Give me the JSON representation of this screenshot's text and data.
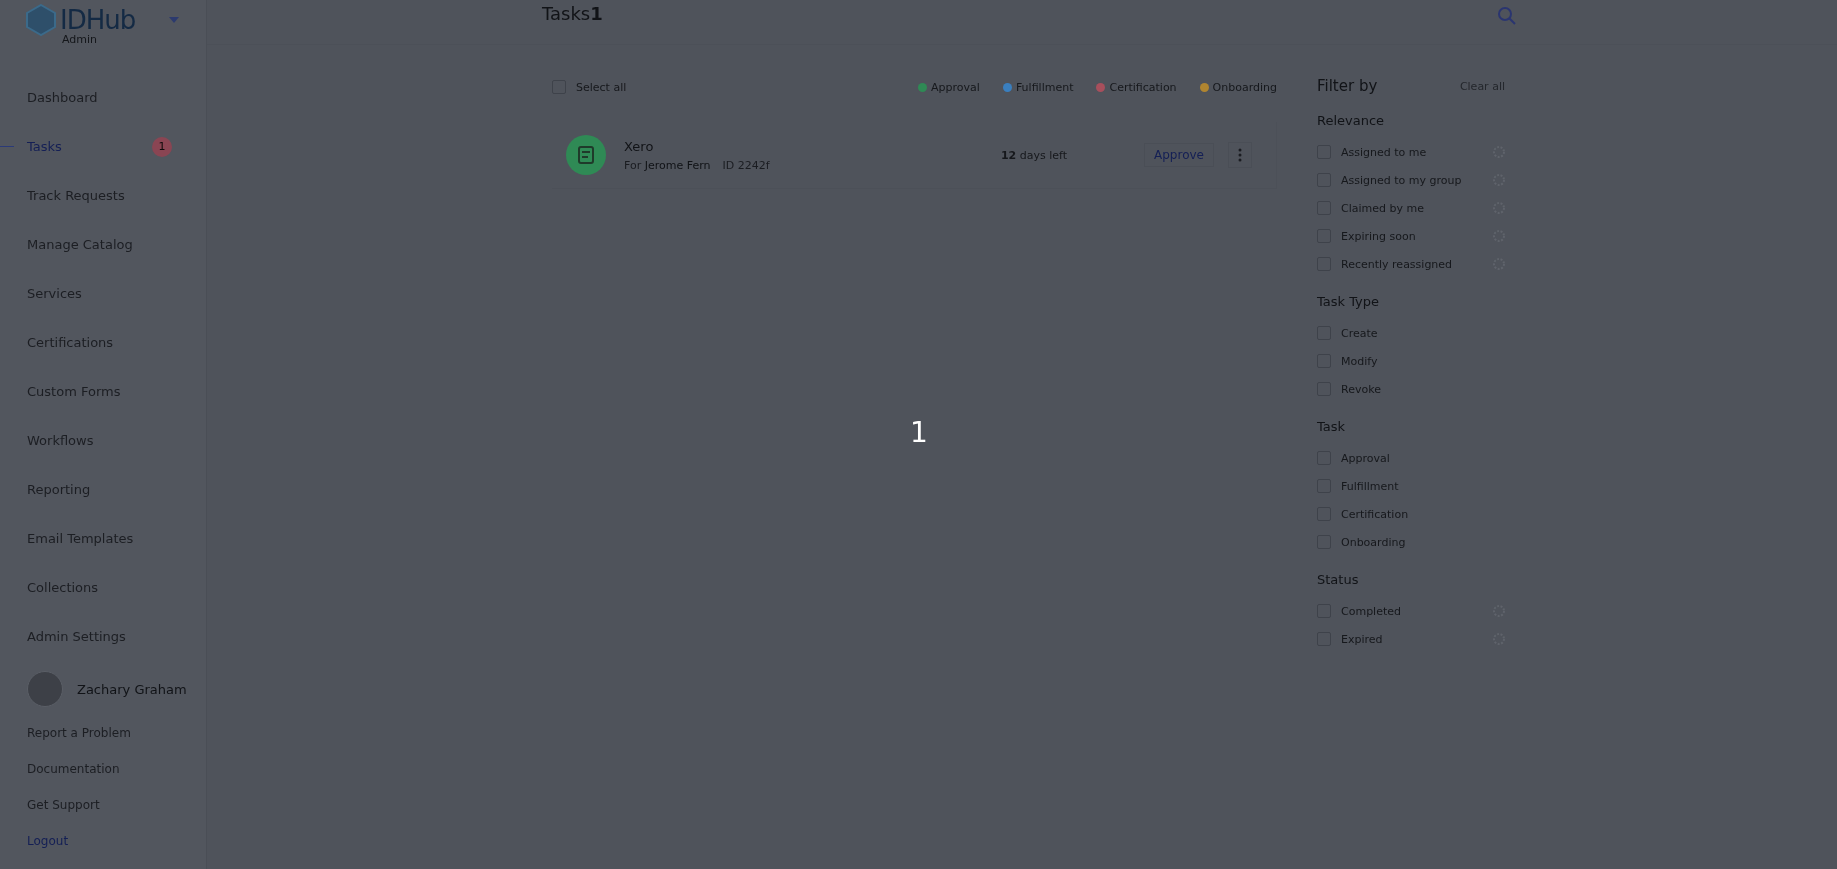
{
  "brand": {
    "name": "IDHub",
    "role": "Admin"
  },
  "nav": [
    {
      "label": "Dashboard",
      "selected": false
    },
    {
      "label": "Tasks",
      "selected": true,
      "badge": "1"
    },
    {
      "label": "Track Requests",
      "selected": false
    },
    {
      "label": "Manage Catalog",
      "selected": false
    },
    {
      "label": "Services",
      "selected": false
    },
    {
      "label": "Certifications",
      "selected": false
    },
    {
      "label": "Custom Forms",
      "selected": false
    },
    {
      "label": "Workflows",
      "selected": false
    },
    {
      "label": "Reporting",
      "selected": false
    },
    {
      "label": "Email Templates",
      "selected": false
    },
    {
      "label": "Collections",
      "selected": false
    },
    {
      "label": "Admin Settings",
      "selected": false
    }
  ],
  "user": {
    "name": "Zachary Graham"
  },
  "footer_links": [
    {
      "label": "Report a Problem",
      "selected": false
    },
    {
      "label": "Documentation",
      "selected": false
    },
    {
      "label": "Get Support",
      "selected": false
    },
    {
      "label": "Logout",
      "selected": true
    }
  ],
  "header": {
    "title": "Tasks",
    "count": "1"
  },
  "toolbar": {
    "select_all": {
      "label": "Select all",
      "checked": false
    },
    "legend": [
      {
        "label": "Approval",
        "color": "#2f8a55"
      },
      {
        "label": "Fulfillment",
        "color": "#3a7fbf"
      },
      {
        "label": "Certification",
        "color": "#a84f5c"
      },
      {
        "label": "Onboarding",
        "color": "#b08530"
      }
    ]
  },
  "tasks": [
    {
      "title": "Xero",
      "for_label": "For",
      "for_name": "Jerome Fern",
      "id": "ID 2242f",
      "days": "12",
      "days_suffix": "days left",
      "action": "Approve",
      "color": "#2f8a55"
    }
  ],
  "filters": {
    "title": "Filter by",
    "clear": "Clear all",
    "groups": [
      {
        "title": "Relevance",
        "items": [
          {
            "label": "Assigned to me",
            "checked": false,
            "loading": true
          },
          {
            "label": "Assigned to my group",
            "checked": false,
            "loading": true
          },
          {
            "label": "Claimed by me",
            "checked": false,
            "loading": true
          },
          {
            "label": "Expiring soon",
            "checked": false,
            "loading": true
          },
          {
            "label": "Recently reassigned",
            "checked": false,
            "loading": true
          }
        ]
      },
      {
        "title": "Task Type",
        "items": [
          {
            "label": "Create",
            "checked": false,
            "loading": false
          },
          {
            "label": "Modify",
            "checked": false,
            "loading": false
          },
          {
            "label": "Revoke",
            "checked": false,
            "loading": false
          }
        ]
      },
      {
        "title": "Task",
        "items": [
          {
            "label": "Approval",
            "checked": false,
            "loading": false
          },
          {
            "label": "Fulfillment",
            "checked": false,
            "loading": false
          },
          {
            "label": "Certification",
            "checked": false,
            "loading": false
          },
          {
            "label": "Onboarding",
            "checked": false,
            "loading": false
          }
        ]
      },
      {
        "title": "Status",
        "items": [
          {
            "label": "Completed",
            "checked": false,
            "loading": true
          },
          {
            "label": "Expired",
            "checked": false,
            "loading": true
          }
        ]
      }
    ]
  },
  "overlay": {
    "step": "1"
  }
}
